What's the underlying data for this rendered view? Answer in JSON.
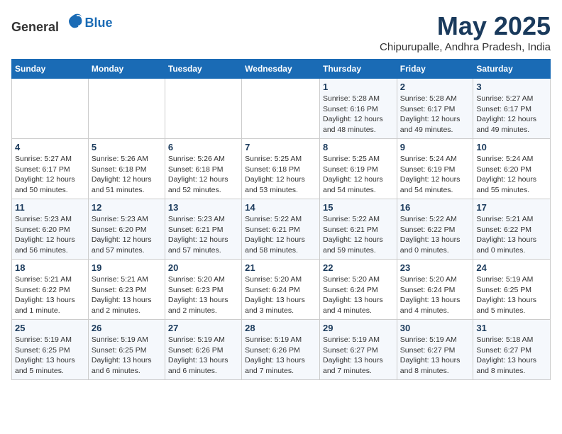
{
  "header": {
    "logo_general": "General",
    "logo_blue": "Blue",
    "month": "May 2025",
    "location": "Chipurupalle, Andhra Pradesh, India"
  },
  "weekdays": [
    "Sunday",
    "Monday",
    "Tuesday",
    "Wednesday",
    "Thursday",
    "Friday",
    "Saturday"
  ],
  "weeks": [
    [
      {
        "day": "",
        "info": ""
      },
      {
        "day": "",
        "info": ""
      },
      {
        "day": "",
        "info": ""
      },
      {
        "day": "",
        "info": ""
      },
      {
        "day": "1",
        "info": "Sunrise: 5:28 AM\nSunset: 6:16 PM\nDaylight: 12 hours\nand 48 minutes."
      },
      {
        "day": "2",
        "info": "Sunrise: 5:28 AM\nSunset: 6:17 PM\nDaylight: 12 hours\nand 49 minutes."
      },
      {
        "day": "3",
        "info": "Sunrise: 5:27 AM\nSunset: 6:17 PM\nDaylight: 12 hours\nand 49 minutes."
      }
    ],
    [
      {
        "day": "4",
        "info": "Sunrise: 5:27 AM\nSunset: 6:17 PM\nDaylight: 12 hours\nand 50 minutes."
      },
      {
        "day": "5",
        "info": "Sunrise: 5:26 AM\nSunset: 6:18 PM\nDaylight: 12 hours\nand 51 minutes."
      },
      {
        "day": "6",
        "info": "Sunrise: 5:26 AM\nSunset: 6:18 PM\nDaylight: 12 hours\nand 52 minutes."
      },
      {
        "day": "7",
        "info": "Sunrise: 5:25 AM\nSunset: 6:18 PM\nDaylight: 12 hours\nand 53 minutes."
      },
      {
        "day": "8",
        "info": "Sunrise: 5:25 AM\nSunset: 6:19 PM\nDaylight: 12 hours\nand 54 minutes."
      },
      {
        "day": "9",
        "info": "Sunrise: 5:24 AM\nSunset: 6:19 PM\nDaylight: 12 hours\nand 54 minutes."
      },
      {
        "day": "10",
        "info": "Sunrise: 5:24 AM\nSunset: 6:20 PM\nDaylight: 12 hours\nand 55 minutes."
      }
    ],
    [
      {
        "day": "11",
        "info": "Sunrise: 5:23 AM\nSunset: 6:20 PM\nDaylight: 12 hours\nand 56 minutes."
      },
      {
        "day": "12",
        "info": "Sunrise: 5:23 AM\nSunset: 6:20 PM\nDaylight: 12 hours\nand 57 minutes."
      },
      {
        "day": "13",
        "info": "Sunrise: 5:23 AM\nSunset: 6:21 PM\nDaylight: 12 hours\nand 57 minutes."
      },
      {
        "day": "14",
        "info": "Sunrise: 5:22 AM\nSunset: 6:21 PM\nDaylight: 12 hours\nand 58 minutes."
      },
      {
        "day": "15",
        "info": "Sunrise: 5:22 AM\nSunset: 6:21 PM\nDaylight: 12 hours\nand 59 minutes."
      },
      {
        "day": "16",
        "info": "Sunrise: 5:22 AM\nSunset: 6:22 PM\nDaylight: 13 hours\nand 0 minutes."
      },
      {
        "day": "17",
        "info": "Sunrise: 5:21 AM\nSunset: 6:22 PM\nDaylight: 13 hours\nand 0 minutes."
      }
    ],
    [
      {
        "day": "18",
        "info": "Sunrise: 5:21 AM\nSunset: 6:22 PM\nDaylight: 13 hours\nand 1 minute."
      },
      {
        "day": "19",
        "info": "Sunrise: 5:21 AM\nSunset: 6:23 PM\nDaylight: 13 hours\nand 2 minutes."
      },
      {
        "day": "20",
        "info": "Sunrise: 5:20 AM\nSunset: 6:23 PM\nDaylight: 13 hours\nand 2 minutes."
      },
      {
        "day": "21",
        "info": "Sunrise: 5:20 AM\nSunset: 6:24 PM\nDaylight: 13 hours\nand 3 minutes."
      },
      {
        "day": "22",
        "info": "Sunrise: 5:20 AM\nSunset: 6:24 PM\nDaylight: 13 hours\nand 4 minutes."
      },
      {
        "day": "23",
        "info": "Sunrise: 5:20 AM\nSunset: 6:24 PM\nDaylight: 13 hours\nand 4 minutes."
      },
      {
        "day": "24",
        "info": "Sunrise: 5:19 AM\nSunset: 6:25 PM\nDaylight: 13 hours\nand 5 minutes."
      }
    ],
    [
      {
        "day": "25",
        "info": "Sunrise: 5:19 AM\nSunset: 6:25 PM\nDaylight: 13 hours\nand 5 minutes."
      },
      {
        "day": "26",
        "info": "Sunrise: 5:19 AM\nSunset: 6:25 PM\nDaylight: 13 hours\nand 6 minutes."
      },
      {
        "day": "27",
        "info": "Sunrise: 5:19 AM\nSunset: 6:26 PM\nDaylight: 13 hours\nand 6 minutes."
      },
      {
        "day": "28",
        "info": "Sunrise: 5:19 AM\nSunset: 6:26 PM\nDaylight: 13 hours\nand 7 minutes."
      },
      {
        "day": "29",
        "info": "Sunrise: 5:19 AM\nSunset: 6:27 PM\nDaylight: 13 hours\nand 7 minutes."
      },
      {
        "day": "30",
        "info": "Sunrise: 5:19 AM\nSunset: 6:27 PM\nDaylight: 13 hours\nand 8 minutes."
      },
      {
        "day": "31",
        "info": "Sunrise: 5:18 AM\nSunset: 6:27 PM\nDaylight: 13 hours\nand 8 minutes."
      }
    ]
  ]
}
